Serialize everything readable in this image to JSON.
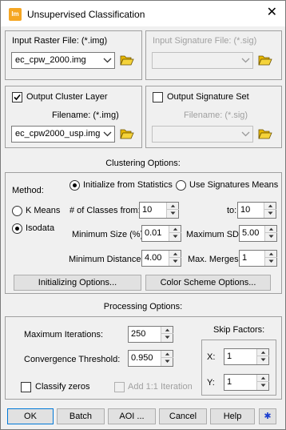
{
  "window": {
    "title": "Unsupervised Classification",
    "icon_text": "Im",
    "close_glyph": "✕"
  },
  "input_raster": {
    "label": "Input Raster File: (*.img)",
    "value": "ec_cpw_2000.img"
  },
  "input_signature": {
    "label": "Input Signature File: (*.sig)",
    "value": ""
  },
  "output_cluster": {
    "checkbox_label": "Output Cluster Layer",
    "checked": true,
    "filename_label": "Filename: (*.img)",
    "value": "ec_cpw2000_usp.img"
  },
  "output_signature": {
    "checkbox_label": "Output Signature Set",
    "checked": false,
    "filename_label": "Filename: (*.sig)",
    "value": ""
  },
  "clustering": {
    "heading": "Clustering Options:",
    "method_label": "Method:",
    "radio_init_stats": "Initialize from Statistics",
    "radio_use_sig": "Use Signatures Means",
    "radio_kmeans": "K Means",
    "radio_isodata": "Isodata",
    "classes_from_label": "# of Classes from:",
    "classes_from": "10",
    "to_label": "to:",
    "classes_to": "10",
    "min_size_label": "Minimum Size (%):",
    "min_size": "0.01",
    "max_sd_label": "Maximum SD:",
    "max_sd": "5.00",
    "min_distance_label": "Minimum Distance:",
    "min_distance": "4.00",
    "max_merges_label": "Max. Merges:",
    "max_merges": "1",
    "init_options_button": "Initializing Options...",
    "color_scheme_button": "Color Scheme Options..."
  },
  "processing": {
    "heading": "Processing Options:",
    "max_iter_label": "Maximum Iterations:",
    "max_iter": "250",
    "conv_label": "Convergence Threshold:",
    "conv": "0.950",
    "classify_zeros_label": "Classify zeros",
    "add_iteration_label": "Add 1:1 Iteration",
    "skip_factors_label": "Skip Factors:",
    "skip_x_label": "X:",
    "skip_x": "1",
    "skip_y_label": "Y:",
    "skip_y": "1"
  },
  "buttons": {
    "ok": "OK",
    "batch": "Batch",
    "aoi": "AOI ...",
    "cancel": "Cancel",
    "help": "Help",
    "star": "✱"
  },
  "colors": {
    "folder": "#e8b800",
    "star": "#1c3fd0"
  }
}
